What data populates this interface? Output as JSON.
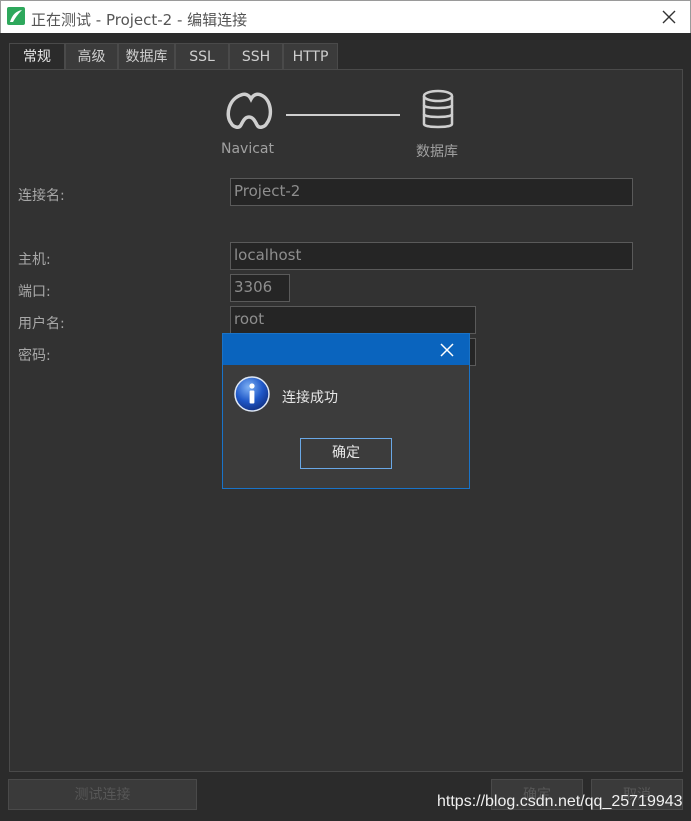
{
  "window": {
    "title": "正在测试 - Project-2 - 编辑连接"
  },
  "tabs": [
    {
      "label": "常规",
      "active": true
    },
    {
      "label": "高级",
      "active": false
    },
    {
      "label": "数据库",
      "active": false
    },
    {
      "label": "SSL",
      "active": false
    },
    {
      "label": "SSH",
      "active": false
    },
    {
      "label": "HTTP",
      "active": false
    }
  ],
  "hero": {
    "left_label": "Navicat",
    "right_label": "数据库"
  },
  "form": {
    "connection_name": {
      "label": "连接名:",
      "value": "Project-2"
    },
    "host": {
      "label": "主机:",
      "value": "localhost"
    },
    "port": {
      "label": "端口:",
      "value": "3306"
    },
    "username": {
      "label": "用户名:",
      "value": "root"
    },
    "password": {
      "label": "密码:",
      "value": ""
    }
  },
  "dialog": {
    "message": "连接成功",
    "ok_label": "确定"
  },
  "footer": {
    "test_label": "测试连接",
    "ok_label": "确定",
    "cancel_label": "取消"
  },
  "watermark": "https://blog.csdn.net/qq_25719943",
  "colors": {
    "dialog_title": "#0a64be",
    "dialog_border": "#1973c8",
    "app_icon": "#2ea85c"
  },
  "icons": {
    "app": "navicat-app-icon",
    "close": "close-icon",
    "navicat": "navicat-logo-icon",
    "database": "database-icon",
    "info": "info-icon"
  }
}
